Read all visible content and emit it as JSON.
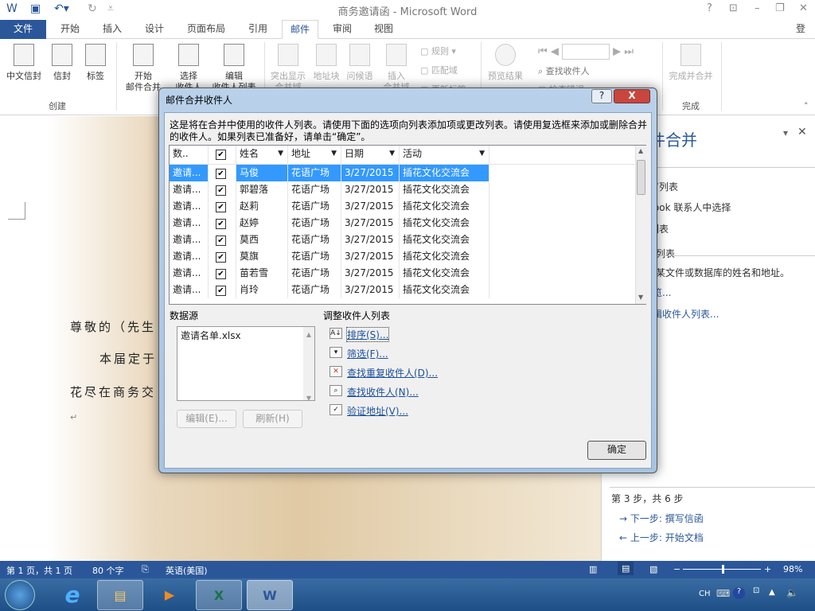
{
  "window": {
    "title": "商务邀请函 - Microsoft Word",
    "help": "?",
    "signin": "登录"
  },
  "tabs": [
    "文件",
    "开始",
    "插入",
    "设计",
    "页面布局",
    "引用",
    "邮件",
    "审阅",
    "视图"
  ],
  "ribbon": {
    "create": {
      "label": "创建",
      "buttons": [
        "中文信封",
        "信封",
        "标签"
      ]
    },
    "start": {
      "buttons": [
        "开始\n邮件合并",
        "选择\n收件人",
        "编辑\n收件人列表"
      ]
    },
    "write": {
      "buttons": [
        "突出显示\n合并域",
        "地址块",
        "问候语",
        "插入\n合并域"
      ],
      "small": [
        "规则",
        "匹配域",
        "更新标签"
      ]
    },
    "preview": {
      "button": "预览结果",
      "small": [
        "查找收件人",
        "检查错误"
      ]
    },
    "finish": {
      "label": "完成",
      "button": "完成并合并"
    }
  },
  "document": {
    "lines": [
      "尊敬的（先生",
      "本届定于",
      "花尽在商务交"
    ]
  },
  "pane": {
    "title": "邮件合并",
    "items": [
      "使用现有列表",
      "从 Outlook 联系人中选择",
      "键入新列表"
    ],
    "section": "使用现有列表",
    "desc": "使用来自某文件或数据库的姓名和地址。",
    "browse": "浏览...",
    "edit": "编辑收件人列表...",
    "step": "第 3 步，共 6 步",
    "next": "下一步: 撰写信函",
    "prev": "上一步: 开始文档"
  },
  "dialog": {
    "title": "邮件合并收件人",
    "help": "?",
    "close": "X",
    "intro": "这是将在合并中使用的收件人列表。请使用下面的选项向列表添加项或更改列表。请使用复选框来添加或删除合并的收件人。如果列表已准备好，请单击“确定”。",
    "columns": [
      "数..",
      "",
      "姓名",
      "地址",
      "日期",
      "活动"
    ],
    "rows": [
      {
        "src": "邀请...",
        "checked": true,
        "name": "马俊",
        "addr": "花语广场",
        "date": "3/27/2015",
        "event": "插花文化交流会"
      },
      {
        "src": "邀请...",
        "checked": true,
        "name": "郭碧落",
        "addr": "花语广场",
        "date": "3/27/2015",
        "event": "插花文化交流会"
      },
      {
        "src": "邀请...",
        "checked": true,
        "name": "赵莉",
        "addr": "花语广场",
        "date": "3/27/2015",
        "event": "插花文化交流会"
      },
      {
        "src": "邀请...",
        "checked": true,
        "name": "赵婷",
        "addr": "花语广场",
        "date": "3/27/2015",
        "event": "插花文化交流会"
      },
      {
        "src": "邀请...",
        "checked": true,
        "name": "莫西",
        "addr": "花语广场",
        "date": "3/27/2015",
        "event": "插花文化交流会"
      },
      {
        "src": "邀请...",
        "checked": true,
        "name": "莫旗",
        "addr": "花语广场",
        "date": "3/27/2015",
        "event": "插花文化交流会"
      },
      {
        "src": "邀请...",
        "checked": true,
        "name": "苗若雪",
        "addr": "花语广场",
        "date": "3/27/2015",
        "event": "插花文化交流会"
      },
      {
        "src": "邀请...",
        "checked": true,
        "name": "肖玲",
        "addr": "花语广场",
        "date": "3/27/2015",
        "event": "插花文化交流会"
      }
    ],
    "datasource_label": "数据源",
    "datasource_file": "邀请名单.xlsx",
    "edit_btn": "编辑(E)...",
    "refresh_btn": "刷新(H)",
    "adjust_label": "调整收件人列表",
    "links": [
      "排序(S)...",
      "筛选(F)...",
      "查找重复收件人(D)...",
      "查找收件人(N)...",
      "验证地址(V)..."
    ],
    "ok": "确定"
  },
  "status": {
    "page": "第 1 页，共 1 页",
    "words": "80 个字",
    "lang": "英语(美国)",
    "zoom": "98%",
    "zoom_value": 98
  },
  "taskbar": {
    "tray_lang": "CH"
  }
}
